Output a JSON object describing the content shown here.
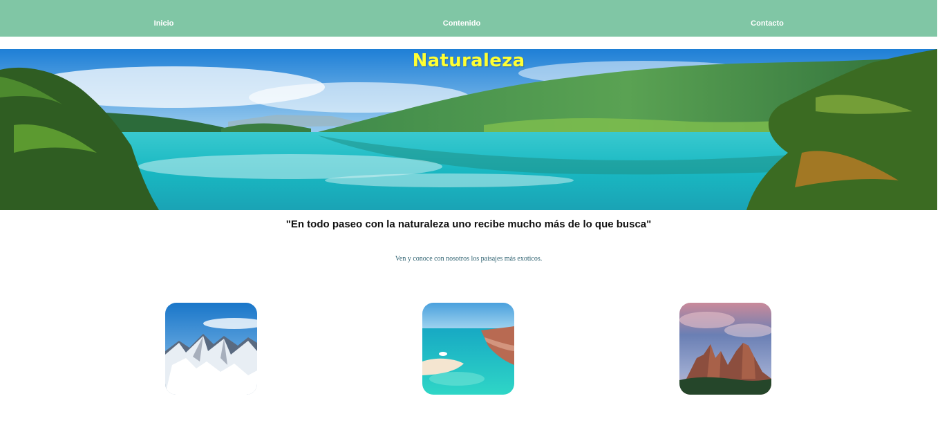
{
  "nav": {
    "items": [
      {
        "label": "Inicio"
      },
      {
        "label": "Contenido"
      },
      {
        "label": "Contacto"
      }
    ]
  },
  "hero": {
    "title": "Naturaleza",
    "image_icon": "lake-landscape-image"
  },
  "quote": "\"En todo paseo con la naturaleza uno recibe mucho más de lo que busca\"",
  "subtitle": "Ven y conoce con nosotros los paisajes más exoticos.",
  "gallery": [
    {
      "icon": "snowy-mountains-image"
    },
    {
      "icon": "tropical-beach-image"
    },
    {
      "icon": "rocky-peaks-image"
    }
  ],
  "colors": {
    "navbar": "#80c6a5",
    "title": "#ffff33",
    "subtitle": "#2b5f6e"
  }
}
